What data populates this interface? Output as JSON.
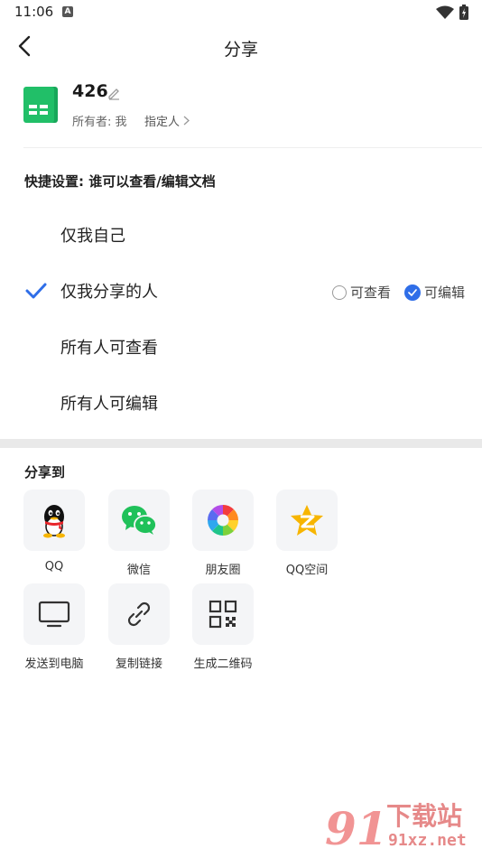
{
  "status_bar": {
    "time": "11:06",
    "notif_letter": "A"
  },
  "header": {
    "title": "分享"
  },
  "document": {
    "name": "426",
    "owner": "所有者: 我",
    "assign_label": "指定人"
  },
  "quick_settings": {
    "title": "快捷设置: 谁可以查看/编辑文档",
    "options": [
      {
        "label": "仅我自己",
        "selected": false
      },
      {
        "label": "仅我分享的人",
        "selected": true
      },
      {
        "label": "所有人可查看",
        "selected": false
      },
      {
        "label": "所有人可编辑",
        "selected": false
      }
    ],
    "permissions": {
      "view_label": "可查看",
      "edit_label": "可编辑",
      "selected": "edit"
    }
  },
  "share": {
    "title": "分享到",
    "targets": [
      {
        "label": "QQ",
        "icon": "qq-penguin-icon"
      },
      {
        "label": "微信",
        "icon": "wechat-icon"
      },
      {
        "label": "朋友圈",
        "icon": "moments-icon"
      },
      {
        "label": "QQ空间",
        "icon": "qzone-star-icon"
      },
      {
        "label": "发送到电脑",
        "icon": "monitor-icon"
      },
      {
        "label": "复制链接",
        "icon": "link-icon"
      },
      {
        "label": "生成二维码",
        "icon": "qr-code-icon"
      }
    ]
  },
  "watermark": {
    "logo": "91",
    "text": "下载站",
    "url": "91xz.net"
  },
  "colors": {
    "accent": "#2F6EE8",
    "doc_green": "#1FB866",
    "divider": "#E9E9E9",
    "tile_bg": "#F4F5F7"
  }
}
